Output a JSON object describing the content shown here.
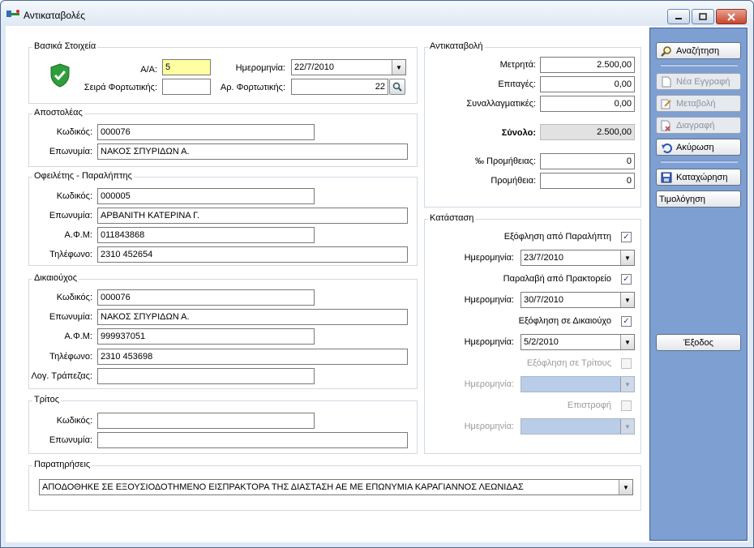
{
  "window": {
    "title": "Αντικαταβολές"
  },
  "basic": {
    "legend": "Βασικά Στοιχεία",
    "aa_label": "Α/Α:",
    "aa_value": "5",
    "date_label": "Ημερομηνία:",
    "date_value": "22/7/2010",
    "series_label": "Σειρά Φορτωτικής:",
    "series_value": "",
    "waybill_label": "Αρ. Φορτωτικής:",
    "waybill_value": "22"
  },
  "sender": {
    "legend": "Αποστολέας",
    "code_label": "Κωδικός:",
    "code_value": "000076",
    "name_label": "Επωνυμία:",
    "name_value": "ΝΑΚΟΣ ΣΠΥΡΙΔΩΝ Α."
  },
  "debtor": {
    "legend": "Οφειλέτης - Παραλήπτης",
    "code_label": "Κωδικός:",
    "code_value": "000005",
    "name_label": "Επωνυμία:",
    "name_value": "ΑΡΒΑΝΙΤΗ ΚΑΤΕΡΙΝΑ Γ.",
    "afm_label": "Α.Φ.Μ:",
    "afm_value": "011843868",
    "phone_label": "Τηλέφωνο:",
    "phone_value": "2310 452654"
  },
  "beneficiary": {
    "legend": "Δικαιούχος",
    "code_label": "Κωδικός:",
    "code_value": "000076",
    "name_label": "Επωνυμία:",
    "name_value": "ΝΑΚΟΣ ΣΠΥΡΙΔΩΝ Α.",
    "afm_label": "Α.Φ.Μ:",
    "afm_value": "999937051",
    "phone_label": "Τηλέφωνο:",
    "phone_value": "2310 453698",
    "bank_label": "Λογ. Τράπεζας:",
    "bank_value": ""
  },
  "third": {
    "legend": "Τρίτος",
    "code_label": "Κωδικός:",
    "code_value": "",
    "name_label": "Επωνυμία:",
    "name_value": ""
  },
  "notes": {
    "legend": "Παρατηρήσεις",
    "value": "ΑΠΟΔΟΘΗΚΕ ΣΕ ΕΞΟΥΣΙΟΔΟΤΗΜΕΝΟ ΕΙΣΠΡΑΚΤΟΡΑ ΤΗΣ ΔΙΑΣΤΑΣΗ ΑΕ ΜΕ ΕΠΩΝΥΜΙΑ ΚΑΡΑΓΙΑΝΝΟΣ ΛΕΩΝΙΔΑΣ"
  },
  "cod": {
    "legend": "Αντικαταβολή",
    "cash_label": "Μετρητά:",
    "cash_value": "2.500,00",
    "checks_label": "Επιταγές:",
    "checks_value": "0,00",
    "bills_label": "Συναλλαγματικές:",
    "bills_value": "0,00",
    "total_label": "Σύνολο:",
    "total_value": "2.500,00",
    "commission_pct_label": "‰ Προμήθειας:",
    "commission_pct_value": "0",
    "commission_label": "Προμήθεια:",
    "commission_value": "0"
  },
  "status": {
    "legend": "Κατάσταση",
    "paid_by_receiver_label": "Εξόφληση από Παραλήπτη",
    "paid_by_receiver_checked": true,
    "date1_label": "Ημερομηνία:",
    "date1_value": "23/7/2010",
    "received_from_agency_label": "Παραλαβή από Πρακτορείο",
    "received_from_agency_checked": true,
    "date2_label": "Ημερομηνία:",
    "date2_value": "30/7/2010",
    "paid_to_beneficiary_label": "Εξόφληση σε Δικαιούχο",
    "paid_to_beneficiary_checked": true,
    "date3_label": "Ημερομηνία:",
    "date3_value": "5/2/2010",
    "paid_to_third_label": "Εξόφληση σε Τρίτους",
    "paid_to_third_checked": false,
    "date4_label": "Ημερομηνία:",
    "date4_value": "",
    "return_label": "Επιστροφή",
    "return_checked": false,
    "date5_label": "Ημερομηνία:",
    "date5_value": ""
  },
  "sidebar": {
    "search": "Αναζήτηση",
    "new": "Νέα Εγγραφή",
    "edit": "Μεταβολή",
    "delete": "Διαγραφή",
    "cancel": "Ακύρωση",
    "save": "Καταχώρηση",
    "invoice": "Τιμολόγηση",
    "exit": "Έξοδος"
  },
  "colors": {
    "sidebar_bg": "#7e9fd1",
    "highlight_field": "#ffffa2",
    "disabled_combo": "#b9cde8"
  },
  "icons": [
    "app-icon",
    "shield-check-icon",
    "search-icon",
    "new-document-icon",
    "edit-document-icon",
    "delete-document-icon",
    "undo-icon",
    "save-icon",
    "chevron-down-icon",
    "minimize-icon",
    "maximize-icon",
    "close-icon"
  ]
}
